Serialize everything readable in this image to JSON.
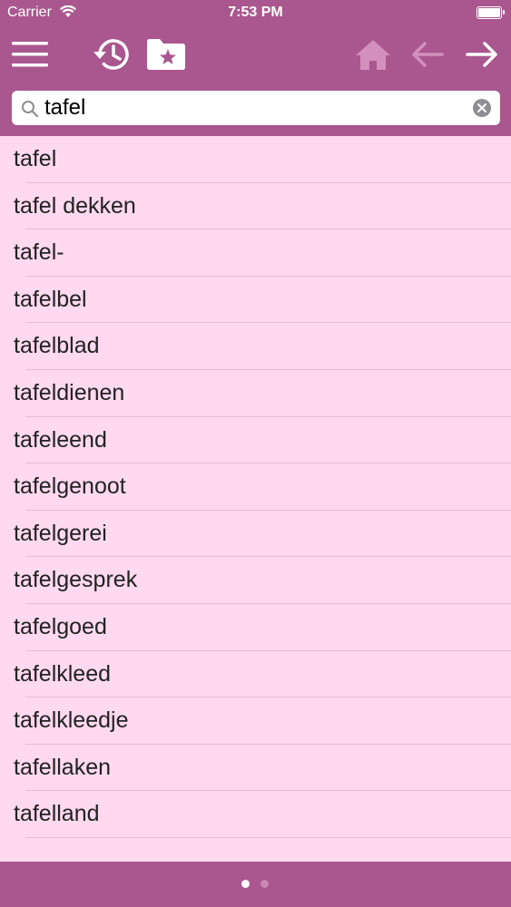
{
  "status": {
    "carrier": "Carrier",
    "time": "7:53 PM"
  },
  "toolbar": {
    "menu_icon": "hamburger-menu-icon",
    "history_icon": "history-clock-icon",
    "favorites_icon": "folder-star-icon",
    "home_icon": "home-icon",
    "back_icon": "arrow-left-icon",
    "forward_icon": "arrow-right-icon"
  },
  "search": {
    "value": "tafel",
    "placeholder": ""
  },
  "words": [
    "tafel",
    "tafel dekken",
    "tafel-",
    "tafelbel",
    "tafelblad",
    "tafeldienen",
    "tafeleend",
    "tafelgenoot",
    "tafelgerei",
    "tafelgesprek",
    "tafelgoed",
    "tafelkleed",
    "tafelkleedje",
    "tafellaken",
    "tafelland"
  ],
  "pager": {
    "pages": 2,
    "current": 1
  },
  "colors": {
    "bar": "#a9578e",
    "list_bg": "#ffd9f0",
    "disabled_icon": "#d38fbd"
  }
}
